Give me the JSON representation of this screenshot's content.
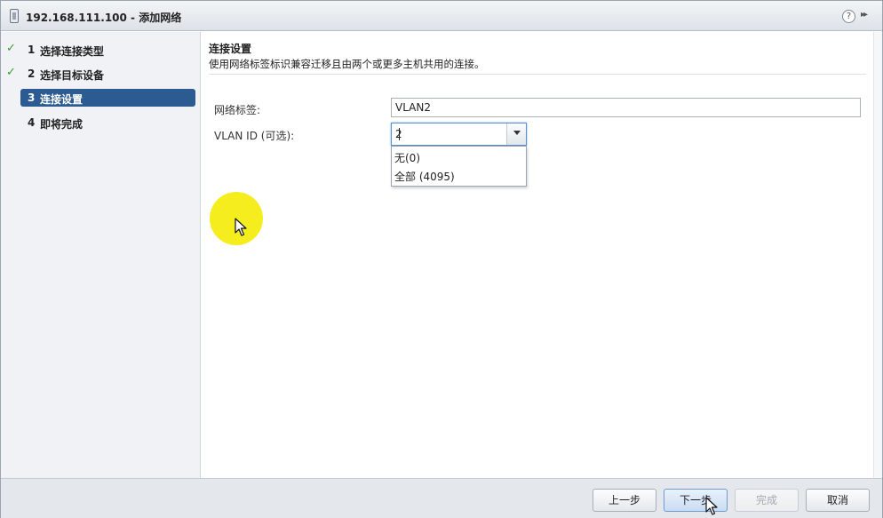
{
  "window": {
    "title": "192.168.111.100 - 添加网络",
    "help_icon": "?",
    "expand_icon": "▸▸"
  },
  "steps": [
    {
      "num": "1",
      "label": "选择连接类型",
      "completed": true,
      "active": false
    },
    {
      "num": "2",
      "label": "选择目标设备",
      "completed": true,
      "active": false
    },
    {
      "num": "3",
      "label": "连接设置",
      "completed": false,
      "active": true
    },
    {
      "num": "4",
      "label": "即将完成",
      "completed": false,
      "active": false
    }
  ],
  "section": {
    "title": "连接设置",
    "description": "使用网络标签标识兼容迁移且由两个或更多主机共用的连接。"
  },
  "form": {
    "network_label": {
      "label": "网络标签:",
      "value": "VLAN2"
    },
    "vlan_id": {
      "label": "VLAN ID (可选):",
      "value": "2"
    }
  },
  "dropdown": {
    "options": [
      "无(0)",
      "全部 (4095)"
    ]
  },
  "footer": {
    "back": "上一步",
    "next": "下一步",
    "finish": "完成",
    "cancel": "取消"
  },
  "colors": {
    "accent": "#2c5b91",
    "check": "#3a9a2e",
    "highlight": "#f6ec12"
  },
  "icons": {
    "check": "check-icon",
    "cursor": "mouse-pointer-icon",
    "dropdown_arrow": "chevron-down-icon"
  }
}
